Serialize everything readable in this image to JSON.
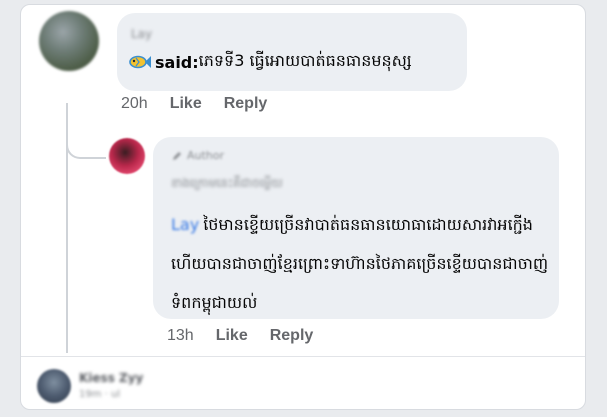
{
  "comment_1": {
    "author_name": "Lay",
    "said_label": "said:",
    "text": "ភេទទី3 ធ្វើអោយបាត់ធនធានមនុស្ស",
    "time": "20h",
    "like_label": "Like",
    "reply_label": "Reply",
    "icon": "fish-icon"
  },
  "reply_1": {
    "author_badge": "Author",
    "subtitle": "ខាងក្រោមនេះគឺជាចម្លើយ",
    "mention": "Lay",
    "text": "ថៃមានខ្ទើយច្រើនវាបាត់ធនធានយោធាដោយសារវាអក្ជើងហើយបានជាចាញ់ខ្មែរព្រោះទាហ៊ានថៃភាគច្រើនខ្ទើយបានជាចាញ់ទំពកម្ពុជាយល់",
    "time": "13h",
    "like_label": "Like",
    "reply_label": "Reply"
  },
  "footer": {
    "name": "Kiess Zyy",
    "meta": "19m · ul"
  },
  "colors": {
    "bubble": "#eceff3",
    "action_text": "#65676b",
    "mention": "#3578e5",
    "page_bg": "#e9ebee"
  }
}
